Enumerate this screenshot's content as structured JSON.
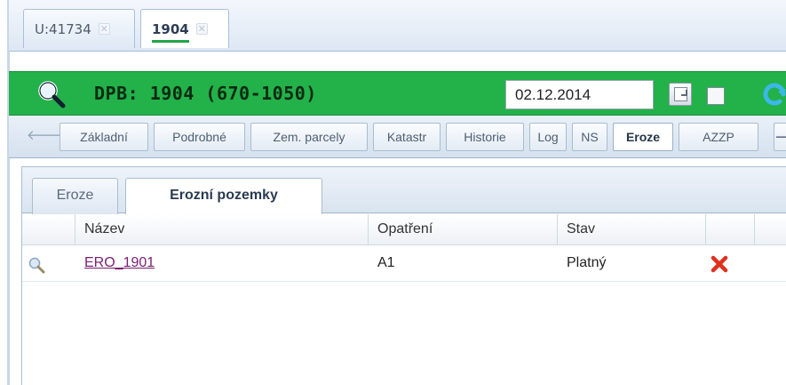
{
  "document_tabs": [
    {
      "label": "U:41734",
      "active": false
    },
    {
      "label": "1904",
      "active": true
    }
  ],
  "header": {
    "title": "DPB: 1904 (670-1050)",
    "date_value": "02.12.2014",
    "bar_color": "#23b14a"
  },
  "detail_tabs": [
    {
      "label": "Základní"
    },
    {
      "label": "Podrobné"
    },
    {
      "label": "Zem. parcely"
    },
    {
      "label": "Katastr"
    },
    {
      "label": "Historie"
    },
    {
      "label": "Log"
    },
    {
      "label": "NS"
    },
    {
      "label": "Eroze",
      "active": true
    },
    {
      "label": "AZZP"
    }
  ],
  "inner_tabs": [
    {
      "label": "Eroze",
      "active": false
    },
    {
      "label": "Erozní pozemky",
      "active": true
    }
  ],
  "table": {
    "columns": [
      "Název",
      "Opatření",
      "Stav"
    ],
    "rows": [
      {
        "nazev": "ERO_1901",
        "opatreni": "A1",
        "stav": "Platný"
      }
    ]
  },
  "icons": {
    "search": "magnifier-icon",
    "calendar": "calendar-icon",
    "refresh": "refresh-icon",
    "delete": "red-x-icon",
    "prev": "arrow-left-icon",
    "next": "arrow-right-icon"
  },
  "colors": {
    "link": "#7a1e70",
    "delete": "#e0301e",
    "tab_underline": "#1fa64a"
  }
}
